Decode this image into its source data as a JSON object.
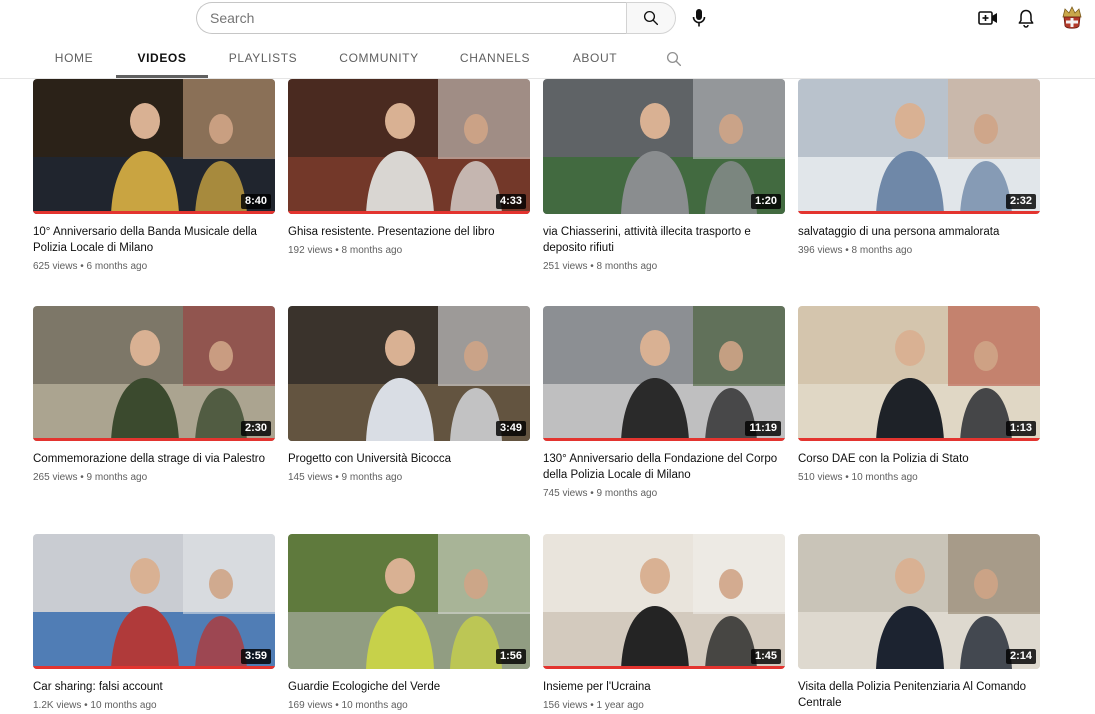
{
  "search": {
    "placeholder": "Search"
  },
  "tabs": [
    {
      "label": "HOME"
    },
    {
      "label": "VIDEOS"
    },
    {
      "label": "PLAYLISTS"
    },
    {
      "label": "COMMUNITY"
    },
    {
      "label": "CHANNELS"
    },
    {
      "label": "ABOUT"
    }
  ],
  "active_tab": "VIDEOS",
  "icons": {
    "search": "search-icon",
    "mic": "microphone-icon",
    "create": "video-create-icon",
    "notifications": "bell-icon",
    "avatar": "channel-avatar"
  },
  "colors": {
    "progress": "#e3342f",
    "duration_bg": "#000000"
  },
  "videos": [
    {
      "title": "10° Anniversario della Banda Musicale della Polizia Locale di Milano",
      "views": "625 views",
      "age": "6 months ago",
      "duration": "8:40"
    },
    {
      "title": "Ghisa resistente. Presentazione del libro",
      "views": "192 views",
      "age": "8 months ago",
      "duration": "4:33"
    },
    {
      "title": "via Chiasserini, attività illecita trasporto e deposito rifiuti",
      "views": "251 views",
      "age": "8 months ago",
      "duration": "1:20"
    },
    {
      "title": "salvataggio di una persona ammalorata",
      "views": "396 views",
      "age": "8 months ago",
      "duration": "2:32"
    },
    {
      "title": "Commemorazione della strage di via Palestro",
      "views": "265 views",
      "age": "9 months ago",
      "duration": "2:30"
    },
    {
      "title": "Progetto con Università Bicocca",
      "views": "145 views",
      "age": "9 months ago",
      "duration": "3:49"
    },
    {
      "title": "130° Anniversario della Fondazione del Corpo della Polizia Locale di Milano",
      "views": "745 views",
      "age": "9 months ago",
      "duration": "11:19"
    },
    {
      "title": "Corso DAE con la Polizia di Stato",
      "views": "510 views",
      "age": "10 months ago",
      "duration": "1:13"
    },
    {
      "title": "Car sharing: falsi account",
      "views": "1.2K views",
      "age": "10 months ago",
      "duration": "3:59"
    },
    {
      "title": "Guardie Ecologiche del Verde",
      "views": "169 views",
      "age": "10 months ago",
      "duration": "1:56"
    },
    {
      "title": "Insieme per l'Ucraina",
      "views": "156 views",
      "age": "1 year ago",
      "duration": "1:45"
    },
    {
      "title": "Visita della Polizia Penitenziaria Al Comando Centrale",
      "views": "",
      "age": "",
      "duration": "2:14"
    }
  ],
  "thumb_palettes": [
    [
      "#2b2218",
      "#c9a441",
      "#1e2633",
      "#d8b18c"
    ],
    [
      "#4a2a20",
      "#d9d6d2",
      "#7a3b2c",
      "#e7dfd8"
    ],
    [
      "#5f6366",
      "#8a8d8f",
      "#3d6b3a",
      "#c0c2c4"
    ],
    [
      "#b9c2cc",
      "#6f88a8",
      "#e8ecef",
      "#d7b08f"
    ],
    [
      "#7d7768",
      "#3b4a2e",
      "#b3ab98",
      "#a33b3b"
    ],
    [
      "#3a332c",
      "#d9dde4",
      "#6b5a44",
      "#efeff2"
    ],
    [
      "#8c8f93",
      "#2a2a2a",
      "#c8c8c8",
      "#3e5a2c"
    ],
    [
      "#d4c5ad",
      "#1e2228",
      "#e2d9c9",
      "#b64a3a"
    ],
    [
      "#c9ccd2",
      "#b03a3a",
      "#3b6fb0",
      "#e4e7ea"
    ],
    [
      "#5f7a3d",
      "#c7d14a",
      "#9aa38e",
      "#e3e4e1"
    ],
    [
      "#e9e4dc",
      "#242424",
      "#cfc6b8",
      "#f1efeb"
    ],
    [
      "#c9c4b8",
      "#1c2330",
      "#e2ddd2",
      "#8a7a62"
    ]
  ]
}
